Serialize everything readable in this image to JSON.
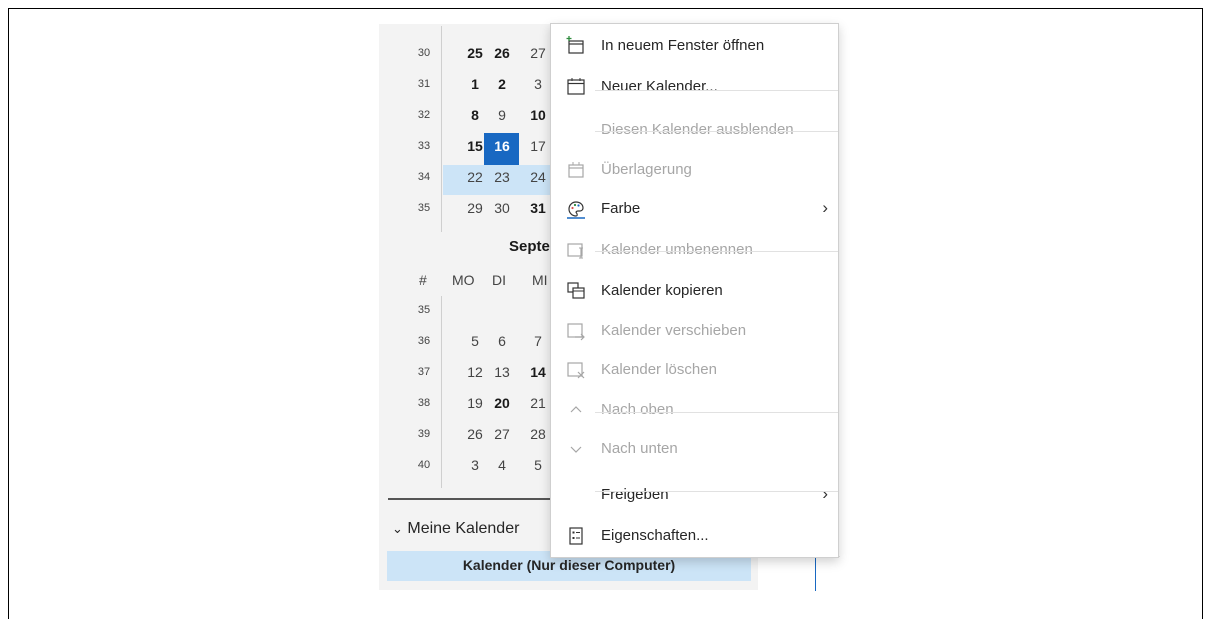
{
  "calendar": {
    "rows_top": [
      {
        "week": "30",
        "days": [
          {
            "t": "25",
            "b": true
          },
          {
            "t": "26",
            "b": true
          },
          {
            "t": "27",
            "b": false
          }
        ]
      },
      {
        "week": "31",
        "days": [
          {
            "t": "1",
            "b": true
          },
          {
            "t": "2",
            "b": true
          },
          {
            "t": "3",
            "b": false
          }
        ]
      },
      {
        "week": "32",
        "days": [
          {
            "t": "8",
            "b": true
          },
          {
            "t": "9",
            "b": false
          },
          {
            "t": "10",
            "b": true
          }
        ]
      },
      {
        "week": "33",
        "days": [
          {
            "t": "15",
            "b": true
          },
          {
            "t": "16",
            "b": true
          },
          {
            "t": "17",
            "b": false
          }
        ]
      },
      {
        "week": "34",
        "days": [
          {
            "t": "22",
            "b": false
          },
          {
            "t": "23",
            "b": false
          },
          {
            "t": "24",
            "b": false
          }
        ]
      },
      {
        "week": "35",
        "days": [
          {
            "t": "29",
            "b": false
          },
          {
            "t": "30",
            "b": false
          },
          {
            "t": "31",
            "b": true
          }
        ]
      }
    ],
    "month_title": "Septer",
    "header": {
      "week": "#",
      "mo": "MO",
      "di": "DI",
      "mi": "MI"
    },
    "rows_bottom": [
      {
        "week": "35",
        "days": []
      },
      {
        "week": "36",
        "days": [
          {
            "t": "5",
            "b": false
          },
          {
            "t": "6",
            "b": false
          },
          {
            "t": "7",
            "b": false
          }
        ]
      },
      {
        "week": "37",
        "days": [
          {
            "t": "12",
            "b": false
          },
          {
            "t": "13",
            "b": false
          },
          {
            "t": "14",
            "b": true
          }
        ]
      },
      {
        "week": "38",
        "days": [
          {
            "t": "19",
            "b": false
          },
          {
            "t": "20",
            "b": true
          },
          {
            "t": "21",
            "b": false
          }
        ]
      },
      {
        "week": "39",
        "days": [
          {
            "t": "26",
            "b": false
          },
          {
            "t": "27",
            "b": false
          },
          {
            "t": "28",
            "b": false
          }
        ]
      },
      {
        "week": "40",
        "days": [
          {
            "t": "3",
            "b": false
          },
          {
            "t": "4",
            "b": false
          },
          {
            "t": "5",
            "b": false
          }
        ]
      }
    ],
    "today": "16",
    "my_calendars_label": "Meine Kalender",
    "selected_calendar": "Kalender (Nur dieser Computer)"
  },
  "menu": {
    "items": [
      {
        "label": "In neuem Fenster öffnen",
        "disabled": false,
        "icon": "new-window-icon"
      },
      {
        "label": "Neuer Kalender...",
        "disabled": false,
        "icon": "calendar-icon"
      },
      {
        "label": "Diesen Kalender ausblenden",
        "disabled": true,
        "icon": ""
      },
      {
        "label": "Überlagerung",
        "disabled": true,
        "icon": "overlay-icon"
      },
      {
        "label": "Farbe",
        "disabled": false,
        "icon": "color-palette-icon",
        "submenu": true
      },
      {
        "label": "Kalender umbenennen",
        "disabled": true,
        "icon": "rename-icon"
      },
      {
        "label": "Kalender kopieren",
        "disabled": false,
        "icon": "copy-icon"
      },
      {
        "label": "Kalender verschieben",
        "disabled": true,
        "icon": "move-icon"
      },
      {
        "label": "Kalender löschen",
        "disabled": true,
        "icon": "delete-icon"
      },
      {
        "label": "Nach oben",
        "disabled": true,
        "icon": "chevron-up-icon"
      },
      {
        "label": "Nach unten",
        "disabled": true,
        "icon": "chevron-down-icon"
      },
      {
        "label": "Freigeben",
        "disabled": false,
        "icon": "",
        "submenu": true
      },
      {
        "label": "Eigenschaften...",
        "disabled": false,
        "icon": "properties-icon"
      }
    ],
    "chevron": "›"
  },
  "colors": {
    "accent": "#1868c2",
    "selection": "#cce4f7",
    "disabled": "#a6a6a6"
  }
}
